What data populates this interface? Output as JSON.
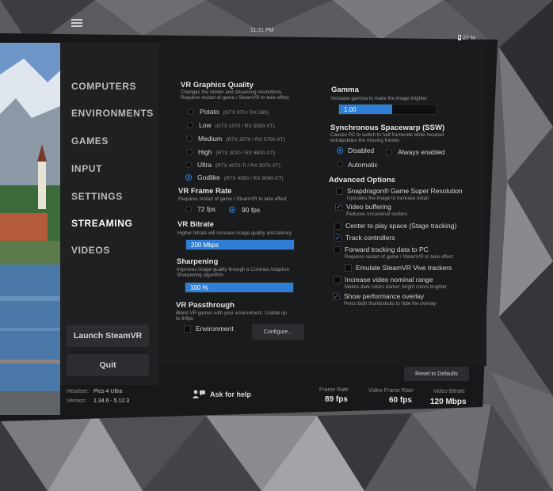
{
  "status": {
    "time": "11:31 PM",
    "battery": "27 %"
  },
  "nav": {
    "items": [
      "COMPUTERS",
      "ENVIRONMENTS",
      "GAMES",
      "INPUT",
      "SETTINGS",
      "STREAMING",
      "VIDEOS"
    ],
    "active": "STREAMING",
    "launch_label": "Launch SteamVR",
    "quit_label": "Quit"
  },
  "graphics": {
    "title": "VR Graphics Quality",
    "desc1": "Changes the render and streaming resolutions.",
    "desc2": "Requires restart of game / SteamVR to take effect",
    "options": [
      {
        "label": "Potato",
        "spec": "(GTX 970 / RX 580)",
        "selected": false
      },
      {
        "label": "Low",
        "spec": "(GTX 1070 / RX 5500-XT)",
        "selected": false
      },
      {
        "label": "Medium",
        "spec": "(RTX 2070 / RX 5700-XT)",
        "selected": false
      },
      {
        "label": "High",
        "spec": "(RTX 3070 / RX 6800-XT)",
        "selected": false
      },
      {
        "label": "Ultra",
        "spec": "(RTX 4070-Ti / RX 9070-XT)",
        "selected": false
      },
      {
        "label": "Godlike",
        "spec": "(RTX 4090 / RX 9080-XT)",
        "selected": true
      }
    ]
  },
  "frame_rate": {
    "title": "VR Frame Rate",
    "desc": "Requires restart of game / SteamVR to take effect",
    "options": [
      {
        "label": "72 fps",
        "selected": false
      },
      {
        "label": "90 fps",
        "selected": true
      }
    ]
  },
  "bitrate": {
    "title": "VR Bitrate",
    "desc": "Higher bitrate will increase image quality and latency",
    "value": "200 Mbps",
    "level": 1.0
  },
  "sharpening": {
    "title": "Sharpening",
    "desc1": "Improves image quality through a Contrast Adaptive",
    "desc2": "Sharpening algorithm",
    "value": "100 %",
    "level": 1.0
  },
  "passthrough": {
    "title": "VR Passthrough",
    "desc1": "Blend VR games with your environment. Usable up",
    "desc2": "to 90fps",
    "env_label": "Environment",
    "env_checked": false,
    "configure_label": "Configure..."
  },
  "gamma": {
    "title": "Gamma",
    "desc": "Increase gamma to make the image brighter",
    "value": "1.00",
    "level": 0.55
  },
  "ssw": {
    "title": "Synchronous Spacewarp (SSW)",
    "desc1": "Causes PC to switch to half framerate while headset",
    "desc2": "extrapolates the missing frames",
    "options": [
      {
        "label": "Disabled",
        "selected": true
      },
      {
        "label": "Always enabled",
        "selected": false
      },
      {
        "label": "Automatic",
        "selected": false
      }
    ]
  },
  "advanced": {
    "title": "Advanced Options",
    "items": [
      {
        "label": "Snapdragon® Game Super Resolution",
        "desc": "Upscales the image to increase detail",
        "checked": false
      },
      {
        "label": "Video buffering",
        "desc": "Reduces occasional stutters",
        "checked": true
      },
      {
        "label": "Center to play space (Stage tracking)",
        "desc": "",
        "checked": false
      },
      {
        "label": "Track controllers",
        "desc": "",
        "checked": true
      },
      {
        "label": "Forward tracking data to PC",
        "desc": "Requires restart of game / SteamVR to take effect",
        "checked": false
      },
      {
        "label": "Emulate SteamVR Vive trackers",
        "desc": "",
        "checked": false
      },
      {
        "label": "Increase video nominal range",
        "desc": "Makes dark colors darker, bright colors brighter",
        "checked": false
      },
      {
        "label": "Show performance overlay",
        "desc": "Press both thumbsticks to hide the overlay",
        "checked": true
      }
    ]
  },
  "reset_label": "Reset to Defaults",
  "footer": {
    "headset_label": "Headset:",
    "headset_value": "Pico 4 Ultra",
    "version_label": "Version:",
    "version_value": "1.34.6 - 5.12.3",
    "help_label": "Ask for help",
    "frame_rate_label": "Frame Rate",
    "frame_rate_value": "89 fps",
    "video_fr_label": "Video Frame Rate",
    "video_fr_value": "60 fps",
    "video_br_label": "Video Bitrate",
    "video_br_value": "120 Mbps"
  },
  "colors": {
    "accent": "#2f7fd6",
    "panel": "#17181a",
    "sidebar": "#1f2022"
  }
}
